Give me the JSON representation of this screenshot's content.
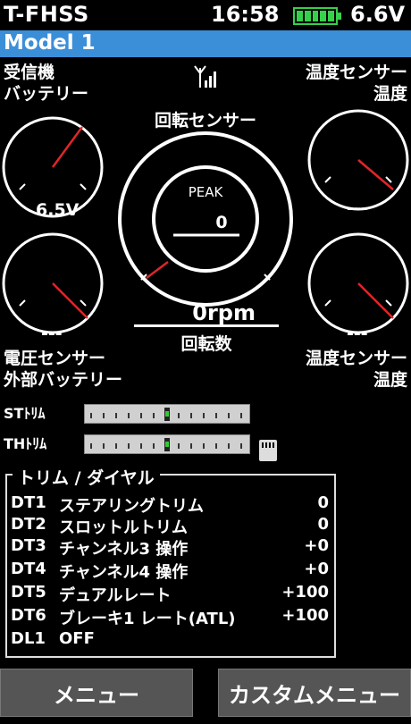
{
  "status": {
    "system": "T-FHSS",
    "time": "16:58",
    "voltage": "6.6V",
    "battery_level": 1.0,
    "battery_color": "#35d14a"
  },
  "model": {
    "name": "Model 1",
    "bar_color": "#3b8fd8"
  },
  "gauges": {
    "receiver": {
      "label_line1": "受信機",
      "label_line2": "バッテリー",
      "value": "6.5V"
    },
    "temp_upper": {
      "label_line1": "温度センサー",
      "label_line2": "温度",
      "value": "---"
    },
    "voltage_ext": {
      "label_line1": "電圧センサー",
      "label_line2": "外部バッテリー",
      "value": "---"
    },
    "temp_lower": {
      "label_line1": "温度センサー",
      "label_line2": "温度",
      "value": "---"
    },
    "rpm": {
      "title": "回転センサー",
      "peak_label": "PEAK",
      "peak_value": "0",
      "value": "0rpm",
      "caption": "回転数"
    }
  },
  "trims": {
    "st": {
      "label": "STﾄﾘﾑ",
      "position": 0
    },
    "th": {
      "label": "THﾄﾘﾑ",
      "position": 0
    }
  },
  "trim_panel": {
    "title": "トリム / ダイヤル",
    "rows": [
      {
        "code": "DT1",
        "name": "ステアリングトリム",
        "value": "0"
      },
      {
        "code": "DT2",
        "name": "スロットルトリム",
        "value": "0"
      },
      {
        "code": "DT3",
        "name": "チャンネル3 操作",
        "value": "+0"
      },
      {
        "code": "DT4",
        "name": "チャンネル4 操作",
        "value": "+0"
      },
      {
        "code": "DT5",
        "name": "デュアルレート",
        "value": "+100"
      },
      {
        "code": "DT6",
        "name": "ブレーキ1 レート(ATL)",
        "value": "+100"
      },
      {
        "code": "DL1",
        "name": "OFF",
        "value": ""
      }
    ]
  },
  "buttons": {
    "menu": "メニュー",
    "custom_menu": "カスタムメニュー"
  },
  "icons": {
    "signal": "signal-antenna-icon",
    "card": "sd-card-icon",
    "needle_color": "#e0252a"
  }
}
